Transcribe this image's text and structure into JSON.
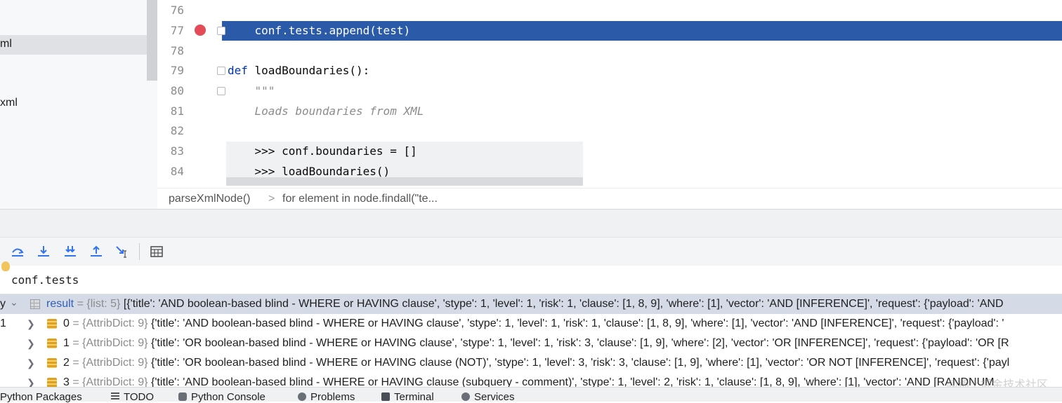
{
  "project": {
    "items": [
      "ml",
      "xml"
    ]
  },
  "editor": {
    "line_numbers": [
      "76",
      "77",
      "78",
      "79",
      "80",
      "81",
      "82",
      "83",
      "84"
    ],
    "lines": {
      "l77": "    conf.tests.append(test)",
      "l79_kw": "def",
      "l79_rest": " loadBoundaries():",
      "l80": "    \"\"\"",
      "l81": "    Loads boundaries from XML",
      "l83": "    >>> conf.boundaries = []",
      "l84": "    >>> loadBoundaries()"
    }
  },
  "breadcrumb": {
    "function": "parseXmlNode()",
    "separator": ">",
    "loop": "for element in node.findall(\"te..."
  },
  "debugger": {
    "toolbar_icons": [
      "step-over-icon",
      "step-into-icon",
      "step-into-my-code-icon",
      "step-out-icon",
      "run-to-cursor-icon",
      "evaluate-expression-icon"
    ],
    "expression": "conf.tests",
    "variables": [
      {
        "left_char": "y",
        "name": "result",
        "type": " = {list: 5} ",
        "value": "[{'title': 'AND boolean-based blind - WHERE or HAVING clause', 'stype': 1, 'level': 1, 'risk': 1, 'clause': [1, 8, 9], 'where': [1], 'vector': 'AND [INFERENCE]', 'request': {'payload': 'AND"
      },
      {
        "left_char": "1",
        "name": "0",
        "type": " = {AttribDict: 9} ",
        "value": "{'title': 'AND boolean-based blind - WHERE or HAVING clause', 'stype': 1, 'level': 1, 'risk': 1, 'clause': [1, 8, 9], 'where': [1], 'vector': 'AND [INFERENCE]', 'request': {'payload': '"
      },
      {
        "left_char": "",
        "name": "1",
        "type": " = {AttribDict: 9} ",
        "value": "{'title': 'OR boolean-based blind - WHERE or HAVING clause', 'stype': 1, 'level': 1, 'risk': 3, 'clause': [1, 9], 'where': [2], 'vector': 'OR [INFERENCE]', 'request': {'payload': 'OR [R"
      },
      {
        "left_char": "",
        "name": "2",
        "type": " = {AttribDict: 9} ",
        "value": "{'title': 'OR boolean-based blind - WHERE or HAVING clause (NOT)', 'stype': 1, 'level': 3, 'risk': 3, 'clause': [1, 9], 'where': [1], 'vector': 'OR NOT [INFERENCE]', 'request': {'payl"
      },
      {
        "left_char": "",
        "name": "3",
        "type": " = {AttribDict: 9} ",
        "value": "{'title': 'AND boolean-based blind - WHERE or HAVING clause (subquery - comment)', 'stype': 1, 'level': 2, 'risk': 1, 'clause': [1, 8, 9], 'where': [1], 'vector': 'AND [RANDNUM"
      }
    ]
  },
  "watermark": "@稀土掘金技术社区",
  "bottom_tabs": [
    "Python Packages",
    "TODO",
    "Python Console",
    "Problems",
    "Terminal",
    "Services"
  ],
  "colors": {
    "current_line": "#2a5aa8",
    "breakpoint": "#e54a57",
    "keyword": "#0033b3",
    "accent": "#3574f0"
  }
}
